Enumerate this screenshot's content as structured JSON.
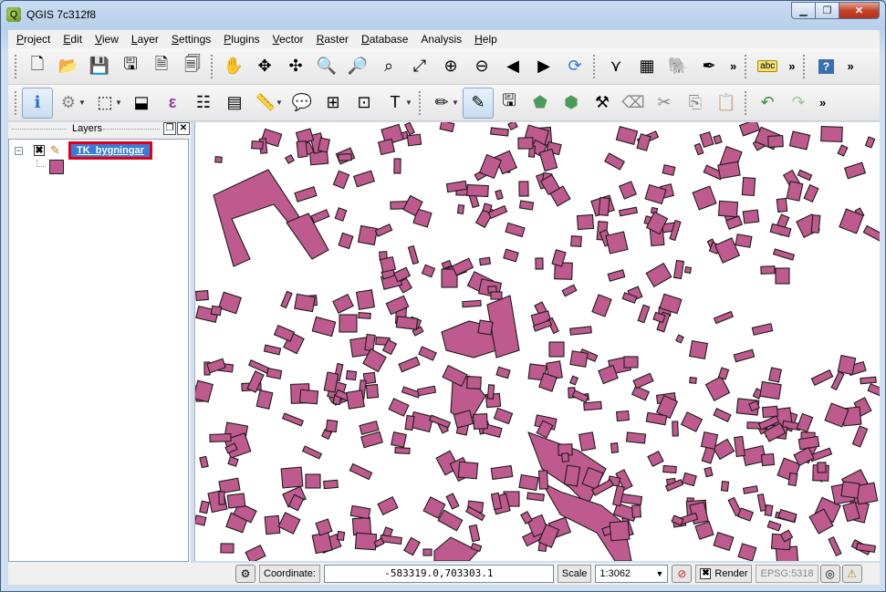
{
  "window": {
    "title": "QGIS 7c312f8"
  },
  "menu": [
    {
      "label": "Project",
      "key": "P",
      "rest": "roject"
    },
    {
      "label": "Edit",
      "key": "E",
      "rest": "dit"
    },
    {
      "label": "View",
      "key": "V",
      "rest": "iew"
    },
    {
      "label": "Layer",
      "key": "L",
      "rest": "ayer"
    },
    {
      "label": "Settings",
      "key": "S",
      "rest": "ettings"
    },
    {
      "label": "Plugins",
      "key": "P",
      "rest": "lugins"
    },
    {
      "label": "Vector",
      "key": "V",
      "rest": "ector"
    },
    {
      "label": "Raster",
      "key": "R",
      "rest": "aster"
    },
    {
      "label": "Database",
      "key": "D",
      "rest": "atabase"
    },
    {
      "label": "Analysis",
      "key": "",
      "rest": "Analysis"
    },
    {
      "label": "Help",
      "key": "H",
      "rest": "elp"
    }
  ],
  "layers_panel": {
    "title": "Layers",
    "layer": {
      "name": "TK_bygningar",
      "visible_mark": "✖",
      "fill_color": "#c0578f"
    }
  },
  "statusbar": {
    "coordinate_label": "Coordinate:",
    "coordinate_value": "-583319.0,703303.1",
    "scale_label": "Scale",
    "scale_value": "1:3062",
    "render_label": "Render",
    "render_mark": "✖",
    "epsg": "EPSG:5318"
  },
  "colors": {
    "building_fill": "#bf5a8e",
    "selection_highlight": "#3a7bd5",
    "outline_red": "#e0001b"
  }
}
